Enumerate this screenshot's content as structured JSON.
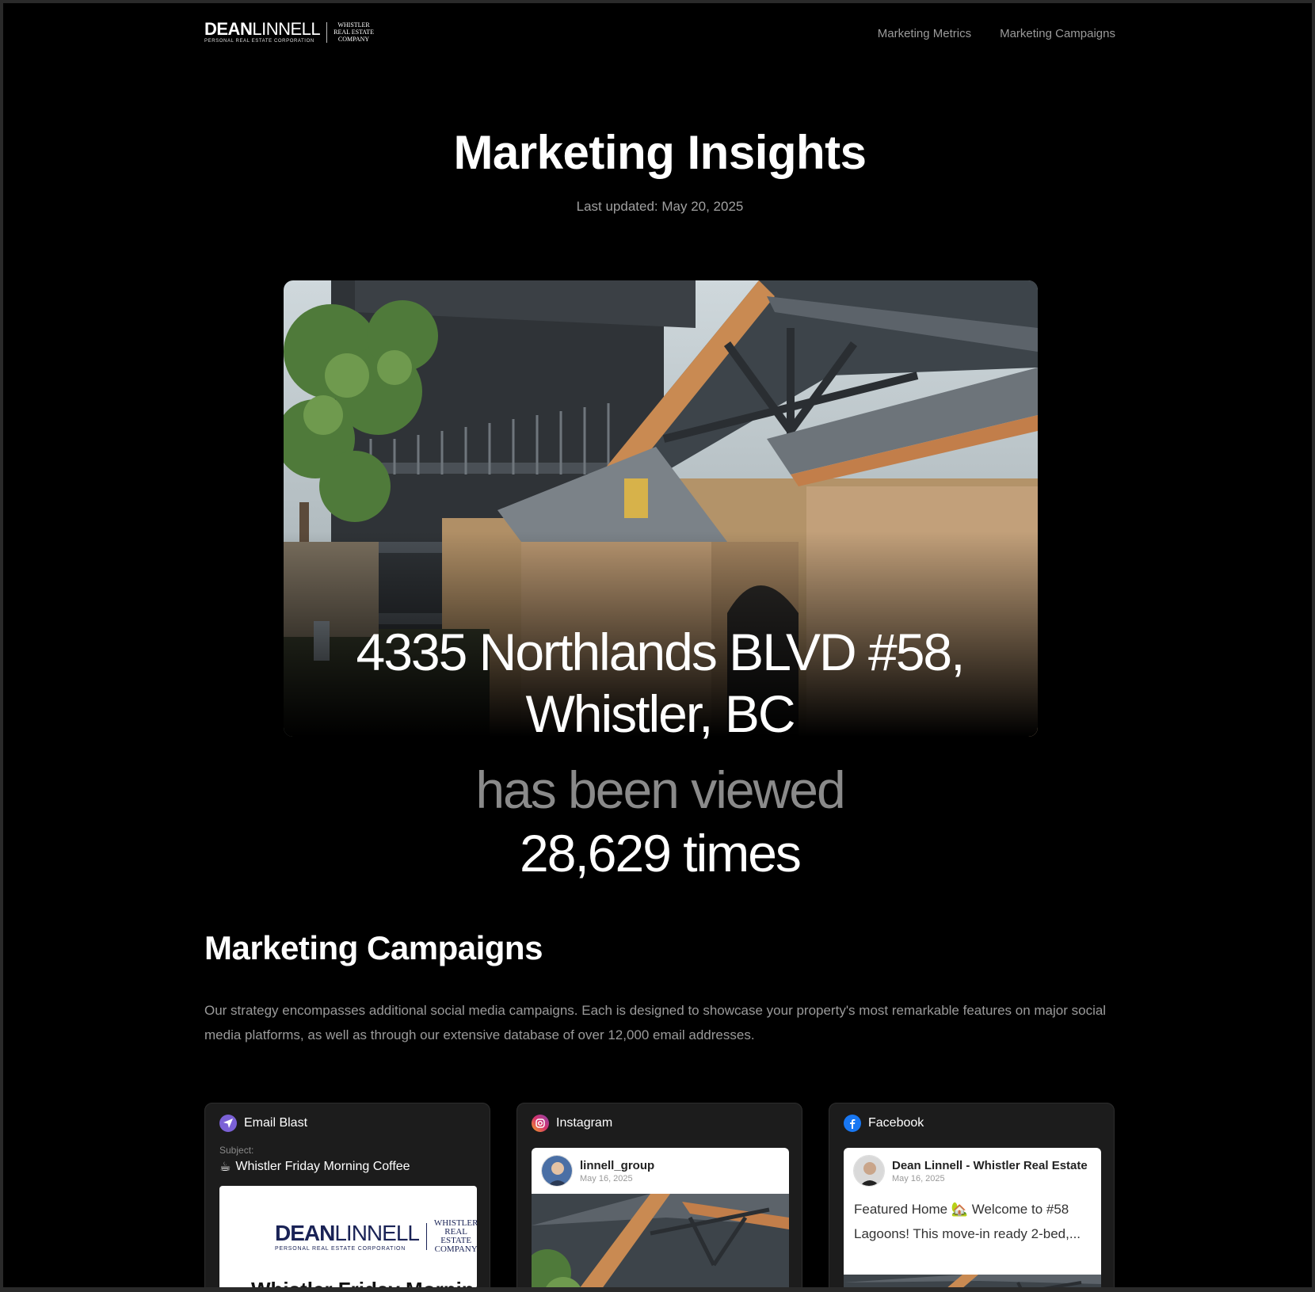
{
  "logo": {
    "name_bold": "DEAN",
    "name_light": "LINNELL",
    "tagline": "PERSONAL REAL ESTATE CORPORATION",
    "sub_line1": "WHISTLER",
    "sub_line2": "REAL ESTATE",
    "sub_line3": "COMPANY"
  },
  "nav": {
    "items": [
      {
        "label": "Marketing Metrics"
      },
      {
        "label": "Marketing Campaigns"
      }
    ]
  },
  "hero": {
    "title": "Marketing Insights",
    "updated": "Last updated: May 20, 2025",
    "address_line1": "4335 Northlands BLVD #58,",
    "address_line2": "Whistler, BC",
    "viewed_text": "has been viewed",
    "count_text": "28,629 times"
  },
  "campaigns": {
    "title": "Marketing Campaigns",
    "description": "Our strategy encompasses additional social media campaigns. Each is designed to showcase your property's most remarkable features on major social media platforms, as well as through our extensive database of over 12,000 email addresses.",
    "email": {
      "label": "Email Blast",
      "subject_label": "Subject:",
      "subject_emoji": "☕",
      "subject": "Whistler Friday Morning Coffee",
      "preview_headline": "Whistler Friday Morning Coffee"
    },
    "instagram": {
      "label": "Instagram",
      "user": "linnell_group",
      "date": "May 16, 2025"
    },
    "facebook": {
      "label": "Facebook",
      "user": "Dean Linnell - Whistler Real Estate",
      "date": "May 16, 2025",
      "text": "Featured Home 🏡 Welcome to #58 Lagoons! This move-in ready 2-bed,..."
    }
  },
  "colors": {
    "background": "#000000",
    "card": "#1c1c1c",
    "muted_text": "#9a9a9a",
    "email_icon": "#7b61d6",
    "instagram_icon": "#d6336c",
    "facebook_icon": "#1877f2"
  }
}
